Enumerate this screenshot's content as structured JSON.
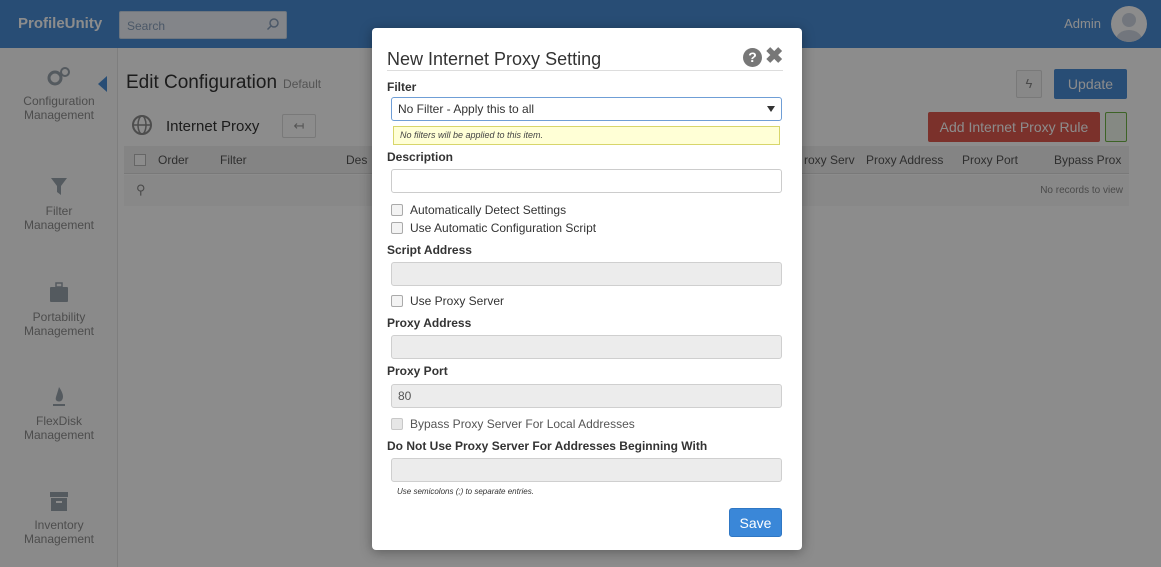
{
  "app": {
    "brand": "ProfileUnity",
    "search_placeholder": "Search",
    "user": "Admin",
    "accent_color": "#4a8dd6"
  },
  "sidebar": {
    "items": [
      {
        "label1": "Configuration",
        "label2": "Management",
        "icon": "gears-icon"
      },
      {
        "label1": "Filter",
        "label2": "Management",
        "icon": "filter-icon"
      },
      {
        "label1": "Portability",
        "label2": "Management",
        "icon": "briefcase-icon"
      },
      {
        "label1": "FlexDisk",
        "label2": "Management",
        "icon": "flame-icon"
      },
      {
        "label1": "Inventory",
        "label2": "Management",
        "icon": "archive-icon"
      }
    ]
  },
  "page": {
    "title": "Edit Configuration",
    "subtitle": "Default",
    "update_label": "Update",
    "section_title": "Internet Proxy",
    "add_rule_label": "Add Internet Proxy Rule",
    "grid_columns": [
      "Order",
      "Filter",
      "Des",
      "roxy Serv",
      "Proxy Address",
      "Proxy Port",
      "Bypass Prox"
    ],
    "no_records": "No records to view"
  },
  "dialog": {
    "title": "New Internet Proxy Setting",
    "filter_label": "Filter",
    "filter_value": "No Filter - Apply this to all",
    "filter_hint": "No filters will be applied to this item.",
    "description_label": "Description",
    "description_value": "",
    "auto_detect_label": "Automatically Detect Settings",
    "auto_script_label": "Use Automatic Configuration Script",
    "script_address_label": "Script Address",
    "script_address_value": "",
    "use_proxy_label": "Use Proxy Server",
    "proxy_address_label": "Proxy Address",
    "proxy_address_value": "",
    "proxy_port_label": "Proxy Port",
    "proxy_port_value": "80",
    "bypass_label": "Bypass Proxy Server For Local Addresses",
    "exceptions_label": "Do Not Use Proxy Server For Addresses Beginning With",
    "exceptions_value": "",
    "exceptions_note": "Use semicolons (;) to separate entries.",
    "save_label": "Save"
  }
}
